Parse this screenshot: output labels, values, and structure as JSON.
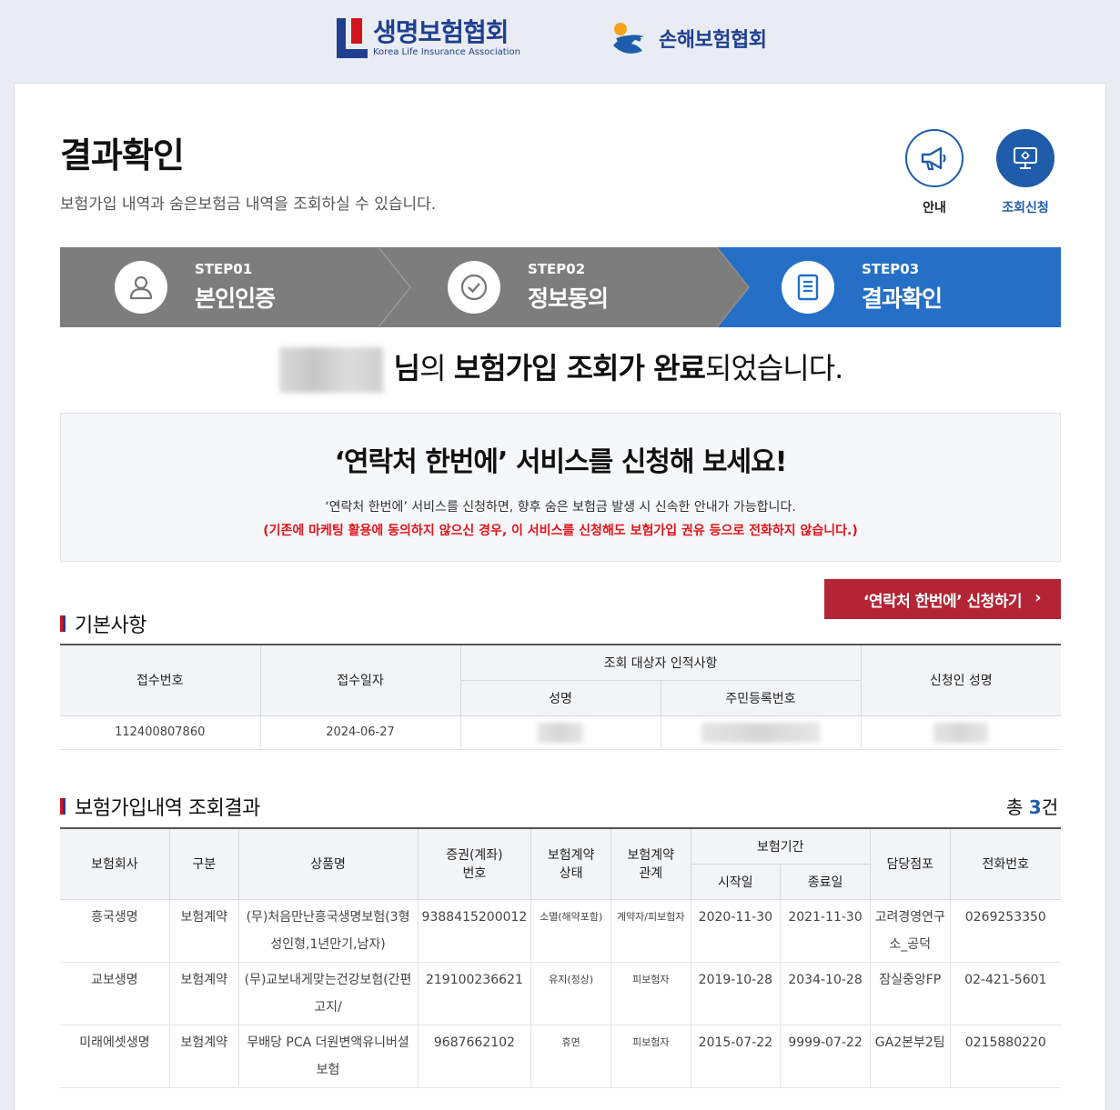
{
  "header": {
    "life_logo_ko": "생명보험협회",
    "life_logo_en": "Korea Life Insurance Association",
    "damage_logo_ko": "손해보험협회"
  },
  "page": {
    "title": "결과확인",
    "description": "보험가입 내역과 숨은보험금 내역을 조회하실 수 있습니다."
  },
  "quick": {
    "guide_label": "안내",
    "apply_label": "조회신청"
  },
  "steps": [
    {
      "num": "STEP01",
      "name": "본인인증"
    },
    {
      "num": "STEP02",
      "name": "정보동의"
    },
    {
      "num": "STEP03",
      "name": "결과확인"
    }
  ],
  "result_message": {
    "part1": "님",
    "part2": "의 ",
    "part3": "보험가입 조회가 완료",
    "part4": "되었습니다."
  },
  "promo": {
    "headline": "‘연락처 한번에’ 서비스를 신청해 보세요!",
    "line1": "‘연락처 한번에’ 서비스를 신청하면, 향후 숨은 보험금 발생 시 신속한 안내가 가능합니다.",
    "line2": "(기존에 마케팅 활용에 동의하지 않으신 경우, 이 서비스를 신청해도 보험가입 권유 등으로 전화하지 않습니다.)",
    "button_label": "‘연락처 한번에’ 신청하기",
    "button_arrow": "›"
  },
  "basic": {
    "title": "기본사항",
    "headers": {
      "receipt_no": "접수번호",
      "receipt_date": "접수일자",
      "target_group": "조회 대상자 인적사항",
      "name": "성명",
      "resident_no": "주민등록번호",
      "applicant": "신청인 성명"
    },
    "row": {
      "receipt_no": "112400807860",
      "receipt_date": "2024-06-27"
    }
  },
  "results": {
    "title": "보험가입내역 조회결과",
    "total_prefix": "총 ",
    "total_count": "3",
    "total_suffix": "건",
    "headers": {
      "company": "보험회사",
      "type": "구분",
      "product": "상품명",
      "policy_no_1": "증권(계좌)",
      "policy_no_2": "번호",
      "status_1": "보험계약",
      "status_2": "상태",
      "relation_1": "보험계약",
      "relation_2": "관계",
      "period": "보험기간",
      "start": "시작일",
      "end": "종료일",
      "branch": "담당점포",
      "phone": "전화번호"
    },
    "rows": [
      {
        "company": "흥국생명",
        "type": "보험계약",
        "product": "(무)처음만난흥국생명보험(3형 성인형,1년만기,남자)",
        "policy_no": "9388415200012",
        "status": "소멸(해약포함)",
        "relation": "계약자/피보험자",
        "start": "2020-11-30",
        "end": "2021-11-30",
        "branch": "고려경영연구소_공덕",
        "phone": "0269253350"
      },
      {
        "company": "교보생명",
        "type": "보험계약",
        "product": "(무)교보내게맞는건강보험(간편고지/",
        "policy_no": "219100236621",
        "status": "유지(정상)",
        "relation": "피보험자",
        "start": "2019-10-28",
        "end": "2034-10-28",
        "branch": "잠실중앙FP",
        "phone": "02-421-5601"
      },
      {
        "company": "미래에셋생명",
        "type": "보험계약",
        "product": "무배당 PCA 더원변액유니버셜보험",
        "policy_no": "9687662102",
        "status": "휴면",
        "relation": "피보험자",
        "start": "2015-07-22",
        "end": "9999-07-22",
        "branch": "GA2본부2팀",
        "phone": "0215880220"
      }
    ]
  },
  "colors": {
    "brand_blue": "#1f5ca9",
    "step_gray": "#7d7d7d",
    "accent_red": "#b32434",
    "warning_red": "#e2141b"
  }
}
